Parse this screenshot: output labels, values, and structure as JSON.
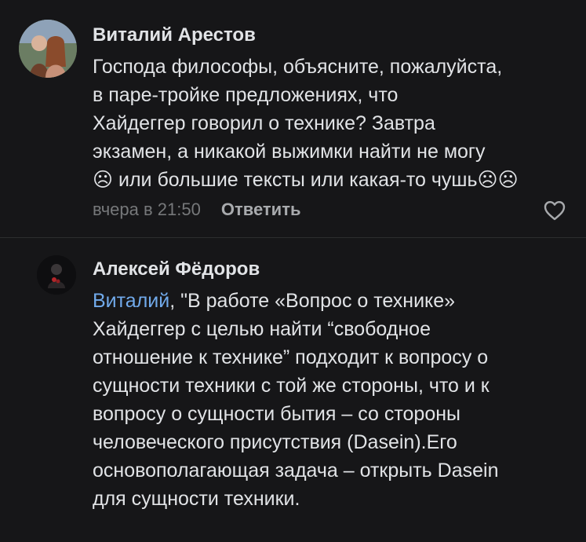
{
  "comments": [
    {
      "author": "Виталий Арестов",
      "lines": [
        "Господа философы, объясните, пожалуйста,",
        "в паре-тройке предложениях, что",
        "Хайдеггер говорил о технике? Завтра",
        "экзамен, а никакой выжимки найти не могу",
        "☹ или большие тексты или какая-то чушь☹☹"
      ],
      "time": "вчера в 21:50",
      "reply_label": "Ответить",
      "icons": {
        "like": "heart-outline-icon"
      }
    },
    {
      "author": "Алексей Фёдоров",
      "mention": "Виталий",
      "first_line_rest": ", \"В работе «Вопрос о технике»",
      "lines": [
        "Хайдеггер с целью найти “свободное",
        "отношение к технике” подходит к вопросу о",
        "сущности техники с той же стороны, что и к",
        "вопросу о сущности бытия – со стороны",
        "человеческого присутствия (Dasein).Его",
        "основополагающая задача – открыть Dasein",
        "для сущности техники."
      ]
    }
  ],
  "colors": {
    "background": "#161618",
    "text": "#e1e3e6",
    "secondary": "#76787a",
    "accent": "#71aaeb",
    "divider": "#2c2d2e"
  }
}
